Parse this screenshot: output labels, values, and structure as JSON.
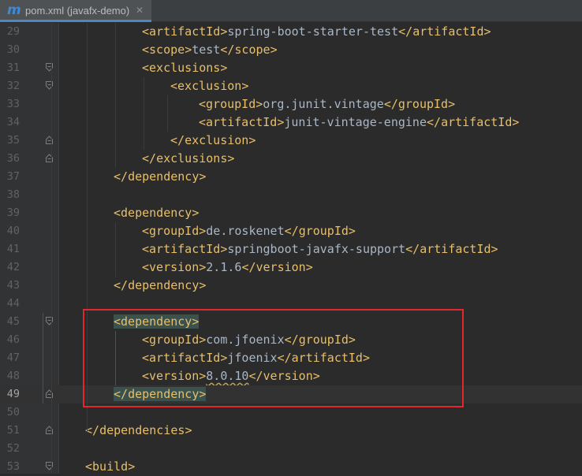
{
  "tab": {
    "icon": "m",
    "title": "pom.xml (javafx-demo)",
    "close": "✕"
  },
  "editor": {
    "lines": [
      {
        "n": "29",
        "open": "<",
        "tag": "artifactId",
        "text": "spring-boot-starter-test",
        "end": "artifactId",
        "close": ">"
      },
      {
        "n": "30",
        "tag": "scope",
        "text": "test",
        "end": "scope"
      },
      {
        "n": "31",
        "tag": "exclusions"
      },
      {
        "n": "32",
        "tag": "exclusion"
      },
      {
        "n": "33",
        "tag": "groupId",
        "text": "org.junit.vintage",
        "end": "groupId"
      },
      {
        "n": "34",
        "tag": "artifactId",
        "text": "junit-vintage-engine",
        "end": "artifactId"
      },
      {
        "n": "35",
        "end": "exclusion"
      },
      {
        "n": "36",
        "end": "exclusions"
      },
      {
        "n": "37",
        "end": "dependency"
      },
      {
        "n": "38"
      },
      {
        "n": "39",
        "tag": "dependency"
      },
      {
        "n": "40",
        "tag": "groupId",
        "text": "de.roskenet",
        "end": "groupId"
      },
      {
        "n": "41",
        "tag": "artifactId",
        "text": "springboot-javafx-support",
        "end": "artifactId"
      },
      {
        "n": "42",
        "tag": "version",
        "text": "2.1.6",
        "end": "version"
      },
      {
        "n": "43",
        "end": "dependency"
      },
      {
        "n": "44"
      },
      {
        "n": "45",
        "tag": "dependency"
      },
      {
        "n": "46",
        "tag": "groupId",
        "text": "com.jfoenix",
        "end": "groupId"
      },
      {
        "n": "47",
        "tag": "artifactId",
        "text": "jfoenix",
        "end": "artifactId"
      },
      {
        "n": "48",
        "tag": "version",
        "text": "8.0.10",
        "end": "version"
      },
      {
        "n": "49",
        "end": "dependency"
      },
      {
        "n": "50"
      },
      {
        "n": "51",
        "end": "dependencies"
      },
      {
        "n": "52"
      },
      {
        "n": "53",
        "tag": "build"
      }
    ]
  }
}
